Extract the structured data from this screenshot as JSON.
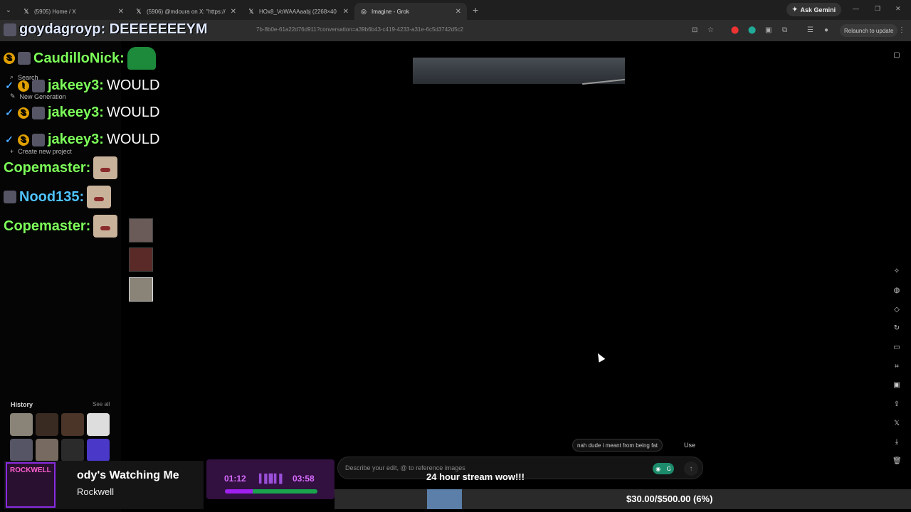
{
  "browser": {
    "tabs": [
      {
        "title": "(5905) Home / X",
        "favicon": "x-logo-icon"
      },
      {
        "title": "(5906) @mdoura on X: \"https://",
        "favicon": "x-logo-icon"
      },
      {
        "title": "HOx8_VoWAAAaabj (2268×40",
        "favicon": "x-logo-icon"
      },
      {
        "title": "Imagine - Grok",
        "favicon": "grok-icon"
      }
    ],
    "ask_gemini_label": "Ask Gemini",
    "url": "7b-8b0e-61a22d76d911?conversation=a39b6b43-c419-4233-a31e-6c5d3742d5c2",
    "relaunch_label": "Relaunch to update"
  },
  "sidebar": {
    "items": [
      {
        "label": "Search",
        "icon": "search-icon"
      },
      {
        "label": "New Generation",
        "icon": "edit-icon"
      },
      {
        "label": "Create new project",
        "icon": "plus-icon"
      }
    ],
    "history_label": "History",
    "see_all_label": "See all"
  },
  "editor": {
    "suggestion": "nah dude i meant from being fat",
    "use_label": "Use",
    "prompt_placeholder": "Describe your edit, @ to reference images"
  },
  "overlay": {
    "top_chat": "goydagroyp: DEEEEEEEYM",
    "chat": [
      {
        "user": "CaudilloNick:",
        "text": "",
        "color": "#7dff5a"
      },
      {
        "user": "jakeey3:",
        "text": "WOULD",
        "color": "#7dff5a"
      },
      {
        "user": "jakeey3:",
        "text": "WOULD",
        "color": "#7dff5a"
      },
      {
        "user": "jakeey3:",
        "text": "WOULD",
        "color": "#7dff5a"
      },
      {
        "user": "Copemaster:",
        "text": "",
        "color": "#7dff5a"
      },
      {
        "user": "Nood135:",
        "text": "",
        "color": "#4fc3ff"
      },
      {
        "user": "Copemaster:",
        "text": "",
        "color": "#7dff5a"
      }
    ],
    "now_playing": {
      "art_label": "ROCKWELL",
      "title": "ody's Watching Me",
      "artist": "Rockwell",
      "elapsed": "01:12",
      "duration": "03:58",
      "progress_fraction": 0.3
    },
    "stream_caption": "24 hour stream wow!!!",
    "donation": {
      "text": "$30.00/$500.00 (6%)",
      "fraction": 0.06
    }
  }
}
